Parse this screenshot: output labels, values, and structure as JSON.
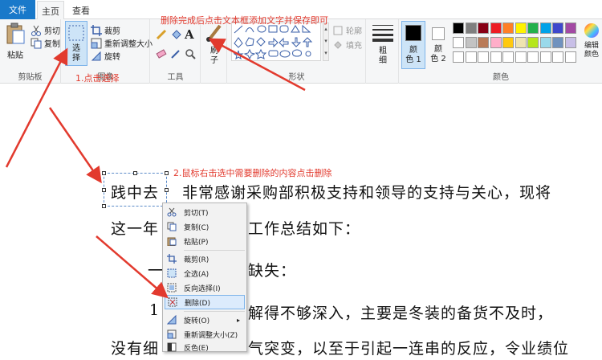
{
  "tabs": {
    "file": "文件",
    "home": "主页",
    "view": "查看"
  },
  "clipboard": {
    "paste": "粘贴",
    "cut": "剪切",
    "copy": "复制",
    "label": "剪贴板"
  },
  "image": {
    "select_1": "选",
    "select_2": "择",
    "crop": "裁剪",
    "resize": "重新调整大小",
    "rotate": "旋转",
    "label": "图像"
  },
  "tools": {
    "label": "工具"
  },
  "brushes": {
    "label_1": "刷",
    "label_2": "子"
  },
  "shapes": {
    "label": "形状",
    "outline": "轮廓",
    "fill": "填充"
  },
  "size": {
    "label_1": "粗",
    "label_2": "细"
  },
  "colors": {
    "color1_a": "颜",
    "color1_b": "色 1",
    "color2_a": "颜",
    "color2_b": "色 2",
    "edit_a": "编辑",
    "edit_b": "颜色",
    "label": "颜色",
    "palette": [
      "#000000",
      "#7f7f7f",
      "#880015",
      "#ed1c24",
      "#ff7f27",
      "#fff200",
      "#22b14c",
      "#00a2e8",
      "#3f48cc",
      "#a349a4",
      "#ffffff",
      "#c3c3c3",
      "#b97a57",
      "#ffaec9",
      "#ffc90e",
      "#efe4b0",
      "#b5e61d",
      "#99d9ea",
      "#7092be",
      "#c8bfe7",
      "#ffffff",
      "#ffffff",
      "#ffffff",
      "#ffffff",
      "#ffffff",
      "#ffffff",
      "#ffffff",
      "#ffffff",
      "#ffffff",
      "#ffffff"
    ]
  },
  "document": {
    "line1a": "践中去",
    "line1b": "非常感谢采购部积极支持和领导的支持与关心，现将",
    "line2a": "这一年",
    "line2b": "工作总结如下：",
    "line3a": "一",
    "line3b": "缺失：",
    "line4a": "1",
    "line4b": "解得不够深入，主要是冬装的备货不及时，",
    "line5a": "没有细",
    "line5b": "气突变，以至于引起一连串的反应，令业绩位"
  },
  "context_menu": {
    "cut": "剪切(T)",
    "copy": "复制(C)",
    "paste": "粘贴(P)",
    "crop": "裁剪(R)",
    "select_all": "全选(A)",
    "invert_selection": "反向选择(I)",
    "delete": "删除(D)",
    "rotate": "旋转(O)",
    "resize": "重新调整大小(Z)",
    "invert_color": "反色(E)"
  },
  "annotations": {
    "top": "删除完成后点击文本框添加文字并保存即可",
    "step1": "1.点击选择",
    "step2": "2.鼠标右击选中需要删除的内容点击删除"
  },
  "accent": "#1979ca",
  "annotation_color": "#e23a2e"
}
